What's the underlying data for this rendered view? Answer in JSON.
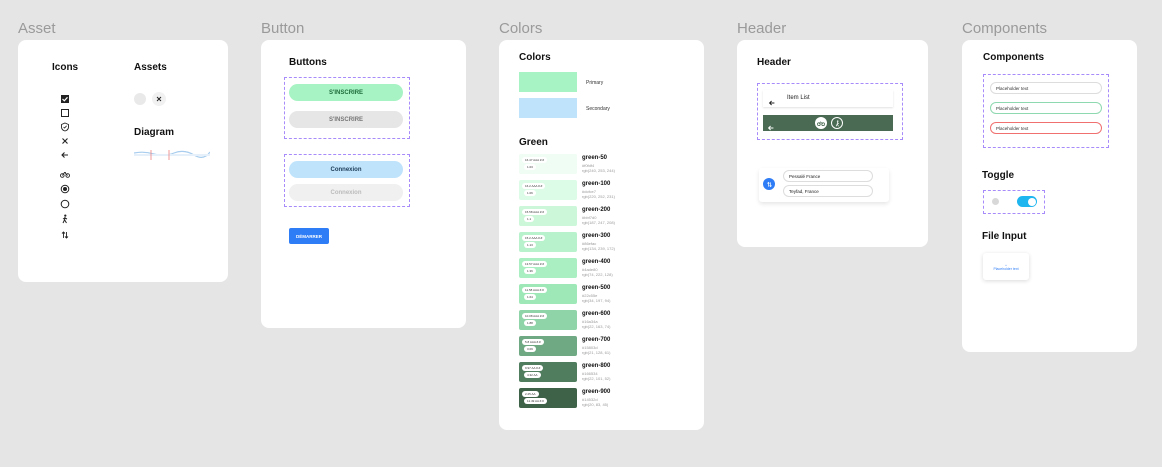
{
  "frames": {
    "asset": "Asset",
    "button": "Button",
    "colors": "Colors",
    "header": "Header",
    "components": "Components"
  },
  "asset_card": {
    "icons_title": "Icons",
    "assets_title": "Assets",
    "diagram_title": "Diagram",
    "icons": [
      "checkbox-checked-icon",
      "checkbox-empty-icon",
      "shield-icon",
      "close-icon",
      "arrow-left-icon",
      "bike-icon",
      "radio-checked-icon",
      "radio-empty-icon",
      "walk-icon",
      "swap-icon"
    ]
  },
  "button_card": {
    "title": "Buttons",
    "signup_active": "S'INSCRIRE",
    "signup_disabled": "S'INSCRIRE",
    "login_active": "Connexion",
    "login_disabled": "Connexion",
    "start": "DÉMARRER"
  },
  "colors_card": {
    "title": "Colors",
    "primary_label": "Primary",
    "secondary_label": "Secondary",
    "primary_color": "#a7f3c4",
    "secondary_color": "#bfe3fb",
    "green_title": "Green",
    "greens": [
      {
        "name": "green-50",
        "hex": "#f0fdf4",
        "rgb": "rgb(240, 253, 244)",
        "tag": "16.47 AAA #.#",
        "ratio": "1.03",
        "color": "#f0fdf4"
      },
      {
        "name": "green-100",
        "hex": "#dcfce7",
        "rgb": "rgb(220, 252, 231)",
        "tag": "16.2 AAA #.#",
        "ratio": "1.06",
        "color": "#dcfce7"
      },
      {
        "name": "green-200",
        "hex": "#bbf7d0",
        "rgb": "rgb(187, 247, 208)",
        "tag": "15.58 AAA #.#",
        "ratio": "1.1",
        "color": "#ccf7d9"
      },
      {
        "name": "green-300",
        "hex": "#86efac",
        "rgb": "rgb(134, 239, 172)",
        "tag": "15.2 AAA #.#",
        "ratio": "1.13",
        "color": "#b8f2cc"
      },
      {
        "name": "green-400",
        "hex": "#4ade80",
        "rgb": "rgb(74, 222, 128)",
        "tag": "13.57 AAA #.#",
        "ratio": "1.36",
        "color": "#a9efc2"
      },
      {
        "name": "green-500",
        "hex": "#22c55e",
        "rgb": "rgb(34, 197, 94)",
        "tag": "11.58 AAA #.#",
        "ratio": "1.64",
        "color": "#9ee8b8"
      },
      {
        "name": "green-600",
        "hex": "#16a34a",
        "rgb": "rgb(22, 163, 74)",
        "tag": "10.08 AAA #.#",
        "ratio": "1.88",
        "color": "#8fd3a9"
      },
      {
        "name": "green-700",
        "hex": "#15803d",
        "rgb": "rgb(21, 128, 61)",
        "tag": "5.8 AAA #.#",
        "ratio": "3.09",
        "color": "#6fa983"
      },
      {
        "name": "green-800",
        "hex": "#166534",
        "rgb": "rgb(22, 101, 52)",
        "tag": "9.97 AA #.#",
        "ratio": "4.32 AA",
        "color": "#4f7d5e"
      },
      {
        "name": "green-900",
        "hex": "#14532d",
        "rgb": "rgb(20, 83, 45)",
        "tag": "2.25 AA",
        "ratio": "11.49 AA #.#",
        "color": "#3d6247"
      }
    ]
  },
  "header_card": {
    "title": "Header",
    "item_list": "Item List",
    "from": "Pessalé France",
    "to": "Teyfad, France",
    "accent": "#4a6a53"
  },
  "components_card": {
    "title": "Components",
    "fields": [
      "Placeholder text",
      "Placeholder text",
      "Placeholder text"
    ],
    "toggle_title": "Toggle",
    "toggle_on_color": "#1fb6f0",
    "file_title": "File Input",
    "file_label": "Placeholder text"
  }
}
